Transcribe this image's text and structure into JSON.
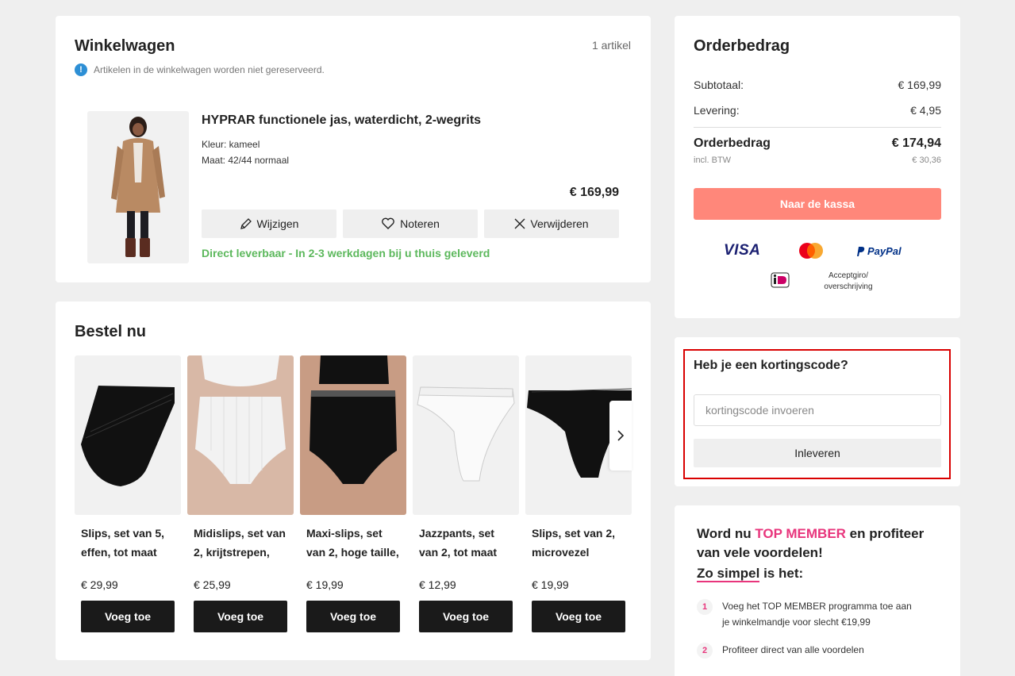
{
  "cart": {
    "title": "Winkelwagen",
    "count": "1 artikel",
    "notice": "Artikelen in de winkelwagen worden niet gereserveerd.",
    "item": {
      "name": "HYPRAR functionele jas, waterdicht, 2-wegrits",
      "color": "Kleur: kameel",
      "size": "Maat: 42/44 normaal",
      "price": "€ 169,99",
      "edit_label": "Wijzigen",
      "save_label": "Noteren",
      "remove_label": "Verwijderen",
      "availability": "Direct leverbaar - In 2-3 werkdagen bij u thuis geleverd"
    }
  },
  "recommendations": {
    "title": "Bestel nu",
    "add_label": "Voeg toe",
    "items": [
      {
        "name": "Slips, set van 5, effen, tot maat",
        "price": "€ 29,99"
      },
      {
        "name": "Midislips, set van 2, krijtstrepen,",
        "price": "€ 25,99"
      },
      {
        "name": "Maxi-slips, set van 2, hoge taille,",
        "price": "€ 19,99"
      },
      {
        "name": "Jazzpants, set van 2, tot maat",
        "price": "€ 12,99"
      },
      {
        "name": "Slips, set van 2, microvezel",
        "price": "€ 19,99"
      }
    ]
  },
  "summary": {
    "title": "Orderbedrag",
    "subtotal_label": "Subtotaal:",
    "subtotal_value": "€ 169,99",
    "delivery_label": "Levering:",
    "delivery_value": "€ 4,95",
    "total_label": "Orderbedrag",
    "total_value": "€ 174,94",
    "vat_label": "incl. BTW",
    "vat_value": "€ 30,36",
    "checkout_label": "Naar de kassa",
    "payment": {
      "visa": "VISA",
      "paypal": "PayPal",
      "acceptgiro": "Acceptgiro/ overschrijving"
    }
  },
  "voucher": {
    "title": "Heb je een kortingscode?",
    "placeholder": "kortingscode invoeren",
    "redeem_label": "Inleveren"
  },
  "member": {
    "head_pre": "Word nu ",
    "head_brand": "TOP MEMBER",
    "head_post": " en profiteer van vele voordelen!",
    "sub_u": "Zo simpel",
    "sub_rest": " is het:",
    "steps": [
      {
        "num": "1",
        "text": "Voeg het TOP MEMBER programma toe aan je winkelmandje voor slecht €19,99"
      },
      {
        "num": "2",
        "text": "Profiteer direct van alle voordelen"
      }
    ]
  },
  "colors": {
    "accent_checkout": "#ff877a",
    "availability_green": "#5cb85c",
    "member_pink": "#e8357c",
    "highlight_frame": "#d90000"
  }
}
